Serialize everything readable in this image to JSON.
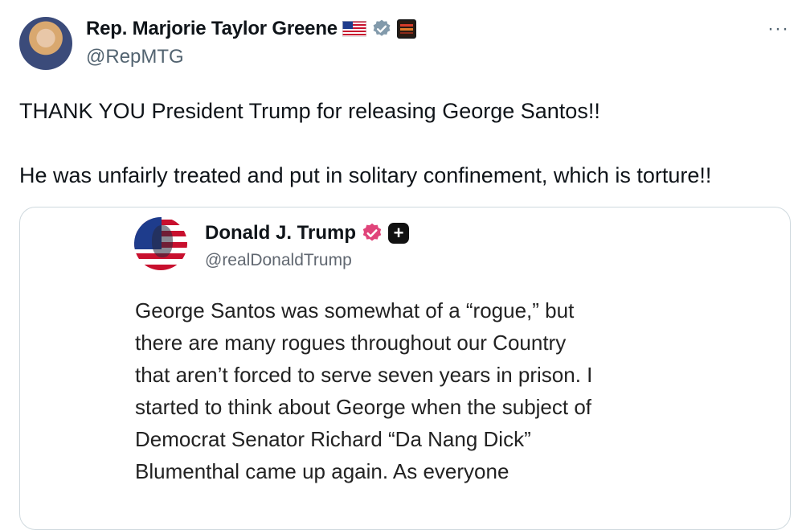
{
  "author": {
    "name": "Rep. Marjorie Taylor Greene",
    "handle": "@RepMTG",
    "flag_icon": "us-flag-icon",
    "verified_icon": "verified-badge-icon",
    "affiliation_icon": "affiliation-badge-icon"
  },
  "more_label": "···",
  "tweet": {
    "line1": "THANK YOU President Trump for releasing George Santos!!",
    "line2": "He was unfairly treated and put in solitary confinement, which is torture!!"
  },
  "quote": {
    "name": "Donald J. Trump",
    "handle": "@realDonaldTrump",
    "plus_label": "+",
    "lines": [
      "George Santos was somewhat of a “rogue,” but",
      "there are many rogues throughout our Country",
      "that aren’t forced to serve seven years in prison. I",
      "started to think about George when the subject of",
      "Democrat Senator Richard “Da Nang Dick”",
      "Blumenthal came up again. As everyone"
    ]
  },
  "colors": {
    "text": "#0f1419",
    "secondary": "#536471",
    "border": "#cfd9de",
    "verified_grey": "#829aab",
    "truth_pink": "#e0447a"
  }
}
